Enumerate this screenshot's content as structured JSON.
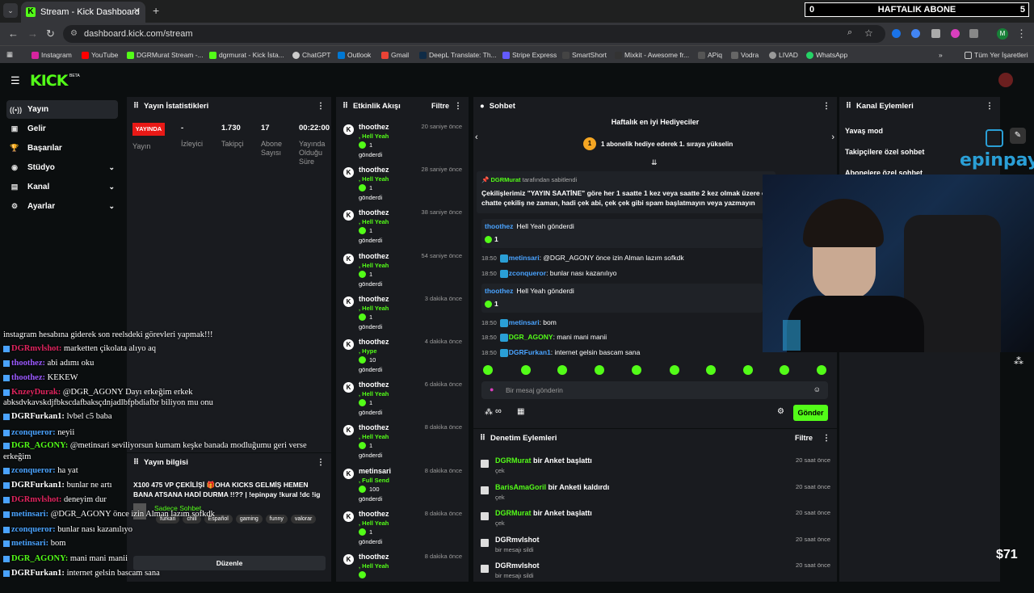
{
  "browser": {
    "tab_title": "Stream - Kick Dashboard",
    "url": "dashboard.kick.com/stream",
    "bookmarks": [
      "Instagram",
      "YouTube",
      "DGRMurat Stream -...",
      "dgrmurat - Kick İsta...",
      "ChatGPT",
      "Outlook",
      "Gmail",
      "DeepL Translate: Th...",
      "Stripe Express",
      "SmartShort",
      "Mixkit - Awesome fr...",
      "APiq",
      "Vodra",
      "LIVAD",
      "WhatsApp",
      "Tüm Yer İşaretleri"
    ]
  },
  "overlay_top": {
    "count": "0",
    "title": "HAFTALIK ABONE",
    "right": "5"
  },
  "sidebar": {
    "items": [
      {
        "label": "Yayın"
      },
      {
        "label": "Gelir"
      },
      {
        "label": "Başarılar"
      },
      {
        "label": "Stüdyo"
      },
      {
        "label": "Kanal"
      },
      {
        "label": "Ayarlar"
      }
    ]
  },
  "stats": {
    "title": "Yayın İstatistikleri",
    "live": "YAYINDA",
    "labels": [
      "Yayın",
      "İzleyici",
      "Takipçi",
      "Abone Sayısı",
      "Yayında Olduğu Süre"
    ],
    "values": [
      "-",
      "1.730",
      "17",
      "00:22:00"
    ]
  },
  "events": {
    "title": "Etkinlik Akışı",
    "filter": "Filtre",
    "items": [
      {
        "user": "thoothez",
        "time": "20 saniye önce",
        "reward": ", Hell Yeah",
        "count": "1",
        "sent": "gönderdi"
      },
      {
        "user": "thoothez",
        "time": "28 saniye önce",
        "reward": ", Hell Yeah",
        "count": "1",
        "sent": "gönderdi"
      },
      {
        "user": "thoothez",
        "time": "38 saniye önce",
        "reward": ", Hell Yeah",
        "count": "1",
        "sent": "gönderdi"
      },
      {
        "user": "thoothez",
        "time": "54 saniye önce",
        "reward": ", Hell Yeah",
        "count": "1",
        "sent": "gönderdi"
      },
      {
        "user": "thoothez",
        "time": "3 dakika önce",
        "reward": ", Hell Yeah",
        "count": "1",
        "sent": "gönderdi"
      },
      {
        "user": "thoothez",
        "time": "4 dakika önce",
        "reward": ", Hype",
        "count": "10",
        "sent": "gönderdi"
      },
      {
        "user": "thoothez",
        "time": "6 dakika önce",
        "reward": ", Hell Yeah",
        "count": "1",
        "sent": "gönderdi"
      },
      {
        "user": "thoothez",
        "time": "8 dakika önce",
        "reward": ", Hell Yeah",
        "count": "1",
        "sent": "gönderdi"
      },
      {
        "user": "metinsari",
        "time": "8 dakika önce",
        "reward": ", Full Send",
        "count": "100",
        "sent": "gönderdi"
      },
      {
        "user": "thoothez",
        "time": "8 dakika önce",
        "reward": ", Hell Yeah",
        "count": "1",
        "sent": "gönderdi"
      },
      {
        "user": "thoothez",
        "time": "8 dakika önce",
        "reward": ", Hell Yeah",
        "count": ""
      }
    ]
  },
  "chat": {
    "title": "Sohbet",
    "gifters_title": "Haftalık en iyi Hediyeciler",
    "gifters_rank": "1",
    "gifters_text": "1 abonelik hediye ederek 1. sıraya yükselin",
    "pinned_by": "DGRMurat",
    "pinned_suffix": "tarafından sabitlendi",
    "pinned_text": "Çekilişlerimiz \"YAYIN SAATİNE\" göre her 1 saatte 1 kez veya saatte 2 kez olmak üzere ç",
    "pinned_text2": "chatte çekiliş ne zaman, hadi çek abi, çek çek gibi spam başlatmayın veya yazmayın",
    "messages": [
      {
        "time": "",
        "user": "thoothez",
        "text": "Hell Yeah gönderdi",
        "count": "1"
      },
      {
        "time": "18:50",
        "user": "metinsari",
        "text": ": @DGR_AGONY önce izin Alman lazım sofkdk"
      },
      {
        "time": "18:50",
        "user": "zconqueror",
        "text": ": bunlar nası kazanılıyo"
      },
      {
        "time": "",
        "user": "thoothez",
        "text": "Hell Yeah gönderdi",
        "count": "1"
      },
      {
        "time": "18:50",
        "user": "metinsari",
        "text": ": bom"
      },
      {
        "time": "18:50",
        "user": "DGR_AGONY",
        "text": ": mani mani manii"
      },
      {
        "time": "18:50",
        "user": "DGRFurkan1",
        "text": ": internet gelsin bascam sana"
      }
    ],
    "input_placeholder": "Bir mesaj gönderin",
    "send": "Gönder",
    "points": "∞"
  },
  "actions": {
    "title": "Kanal Eylemleri",
    "items": [
      "Yavaş mod",
      "Takipçilere özel sohbet",
      "Abonelere özel sohbet"
    ]
  },
  "moderation": {
    "title": "Denetim Eylemleri",
    "filter": "Filtre",
    "items": [
      {
        "user": "DGRMurat",
        "action": "bir Anket başlattı",
        "sub": "çek",
        "time": "20 saat önce",
        "green": true
      },
      {
        "user": "BarisAmaGoril",
        "action": "bir Anketi kaldırdı",
        "sub": "çek",
        "time": "20 saat önce",
        "green": true
      },
      {
        "user": "DGRMurat",
        "action": "bir Anket başlattı",
        "sub": "çek",
        "time": "20 saat önce",
        "green": true
      },
      {
        "user": "DGRmvlshot",
        "action": "",
        "sub": "bir mesajı sildi",
        "time": "20 saat önce",
        "green": false
      },
      {
        "user": "DGRmvlshot",
        "action": "",
        "sub": "bir mesajı sildi",
        "time": "20 saat önce",
        "green": false
      }
    ]
  },
  "stream_info": {
    "title": "Yayın bilgisi",
    "text": "X100 475 VP ÇEKİLİŞİ 🎁OHA KICKS GELMİŞ HEMEN BANA ATSANA HADİ DURMA !!?? | !epinpay !kural !dc !ig",
    "category": "Sadece Sohbet",
    "tags": [
      "furkan",
      "chill",
      "Español",
      "gaming",
      "funny",
      "valorar"
    ],
    "edit": "Düzenle"
  },
  "overlay_chat": [
    {
      "name": "",
      "text": "instagram hesabına giderek son reelsdeki görevleri yapmak!!!",
      "color": "#fff"
    },
    {
      "name": "DGRmvlshot:",
      "text": " marketten çikolata alıyo aq",
      "color": "#e0245e"
    },
    {
      "name": "thoothez:",
      "text": " abi adımı oku",
      "color": "#9b59ff"
    },
    {
      "name": "thoothez:",
      "text": " KEKEW",
      "color": "#9b59ff"
    },
    {
      "name": "KnzeyDurak:",
      "text": " @DGR_AGONY Dayı erkeğim erkek",
      "color": "#e0245e"
    },
    {
      "name": "",
      "text": "abksdvkavskdjfbkscdafbaksçdnjadlbfpbdiafbr biliyon mu onu",
      "color": "#fff"
    },
    {
      "name": "DGRFurkan1:",
      "text": " lvbel c5 baba",
      "color": "#fff"
    },
    {
      "name": "zconqueror:",
      "text": " neyii",
      "color": "#4aa3ff"
    },
    {
      "name": "DGR_AGONY:",
      "text": " @metinsari seviliyorsun kumam keşke banada modluğumu geri verse",
      "color": "#53fc18"
    },
    {
      "name": "",
      "text": "erkeğim",
      "color": "#fff"
    },
    {
      "name": "zconqueror:",
      "text": " ha yat",
      "color": "#4aa3ff"
    },
    {
      "name": "DGRFurkan1:",
      "text": " bunlar ne artı",
      "color": "#fff"
    },
    {
      "name": "DGRmvlshot:",
      "text": " deneyim dur",
      "color": "#e0245e"
    },
    {
      "name": "metinsari:",
      "text": " @DGR_AGONY önce izin Alman lazım sofkdk",
      "color": "#4aa3ff"
    },
    {
      "name": "zconqueror:",
      "text": " bunlar nası kazanılıyo",
      "color": "#4aa3ff"
    },
    {
      "name": "metinsari:",
      "text": " bom",
      "color": "#4aa3ff"
    },
    {
      "name": "DGR_AGONY:",
      "text": " mani mani manii",
      "color": "#53fc18"
    },
    {
      "name": "DGRFurkan1:",
      "text": " internet gelsin bascam sana",
      "color": "#fff"
    }
  ],
  "overlay_misc": {
    "epinpay": "epinpay",
    "price": "$71"
  },
  "colors": {
    "accent": "#53fc18",
    "live": "#e91916",
    "panel": "#191b1f"
  }
}
